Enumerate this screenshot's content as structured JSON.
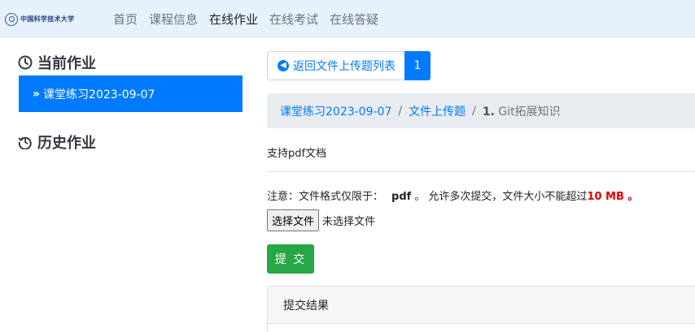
{
  "navbar": {
    "brand_text": "中国科学技术大学",
    "items": [
      {
        "label": "首页",
        "active": false
      },
      {
        "label": "课程信息",
        "active": false
      },
      {
        "label": "在线作业",
        "active": true
      },
      {
        "label": "在线考试",
        "active": false
      },
      {
        "label": "在线答疑",
        "active": false
      }
    ]
  },
  "sidebar": {
    "current_heading": "当前作业",
    "current_icon": "clock-icon",
    "current_item": "课堂练习2023-09-07",
    "history_heading": "历史作业",
    "history_icon": "history-icon"
  },
  "toolbar": {
    "back_label": "返回文件上传题列表",
    "back_icon": "arrow-circle-left-icon",
    "question_number": "1"
  },
  "breadcrumb": {
    "level1": "课堂练习2023-09-07",
    "level2": "文件上传题",
    "current_num": "1.",
    "current_title": "Git拓展知识"
  },
  "question": {
    "description": "支持pdf文档",
    "notice_prefix": "注意：文件格式仅限于：",
    "format": "pdf",
    "notice_middle": "。 允许多次提交，文件大小不能超过",
    "size_limit": "10 MB",
    "notice_end": " 。"
  },
  "upload": {
    "choose_label": "选择文件",
    "no_file_label": "未选择文件",
    "submit_label": "提 交"
  },
  "result": {
    "header": "提交结果"
  },
  "colors": {
    "primary": "#007bff",
    "success": "#28a745",
    "danger": "#e60000",
    "navbar_bg": "#e6f1fb"
  }
}
